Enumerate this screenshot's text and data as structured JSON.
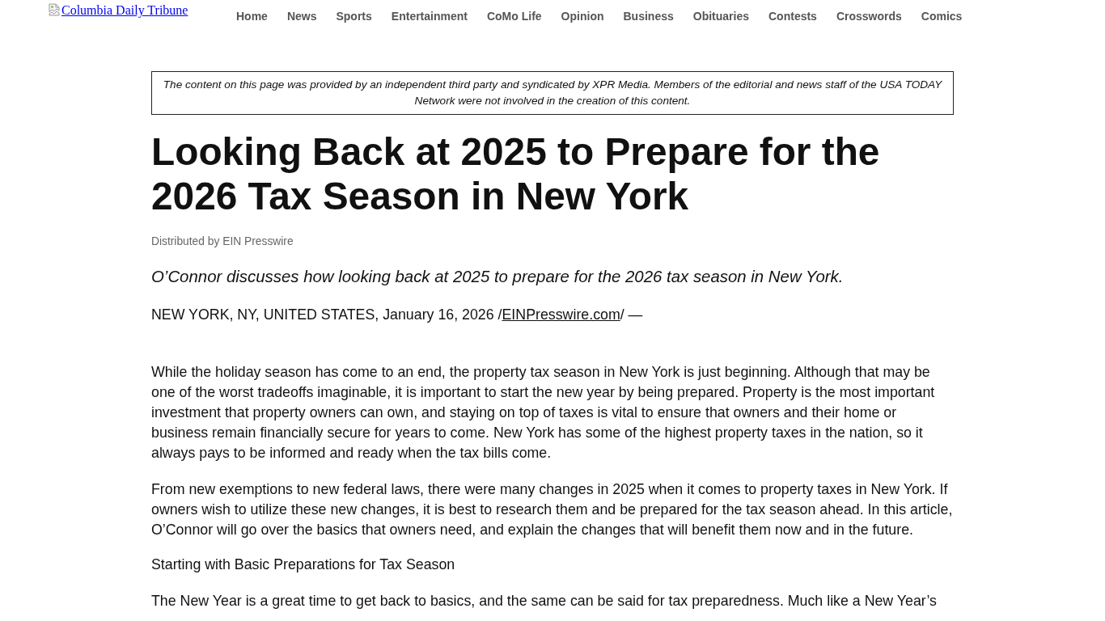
{
  "header": {
    "logo": {
      "alt_text": "Columbia Daily Tribune"
    },
    "nav": [
      "Home",
      "News",
      "Sports",
      "Entertainment",
      "CoMo Life",
      "Opinion",
      "Business",
      "Obituaries",
      "Contests",
      "Crosswords",
      "Comics"
    ]
  },
  "article": {
    "disclaimer": "The content on this page was provided by an independent third party and syndicated by XPR Media. Members of the editorial and news staff of the USA TODAY Network were not involved in the creation of this content.",
    "title": "Looking Back at 2025 to Prepare for the 2026 Tax Season in New York",
    "byline": "Distributed by EIN Presswire",
    "summary": "O’Connor discusses how looking back at 2025 to prepare for the 2026 tax season in New York.",
    "dateline": {
      "text": "NEW YORK, NY, UNITED STATES, January 16, 2026 /",
      "link": "EINPresswire.com",
      "suffix": "/ —"
    },
    "body": [
      {
        "kind": "paragraph",
        "text": "While the holiday season has come to an end, the property tax season in New York is just beginning. Although that may be one of the worst tradeoffs imaginable, it is important to start the new year by being prepared. Property is the most important investment that property owners can own, and staying on top of taxes is vital to ensure that owners and their home or business remain financially secure for years to come. New York has some of the highest property taxes in the nation, so it always pays to be informed and ready when the tax bills come."
      },
      {
        "kind": "paragraph",
        "text": "From new exemptions to new federal laws, there were many changes in 2025 when it comes to property taxes in New York. If owners wish to utilize these new changes, it is best to research them and be prepared for the tax season ahead. In this article, O’Connor will go over the basics that owners need, and explain the changes that will benefit them now and in the future."
      },
      {
        "kind": "subheading",
        "text": "Starting with Basic Preparations for Tax Season"
      },
      {
        "kind": "paragraph",
        "text": "The New Year is a great time to get back to basics, and the same can be said for tax preparedness. Much like a New Year’s"
      }
    ]
  }
}
